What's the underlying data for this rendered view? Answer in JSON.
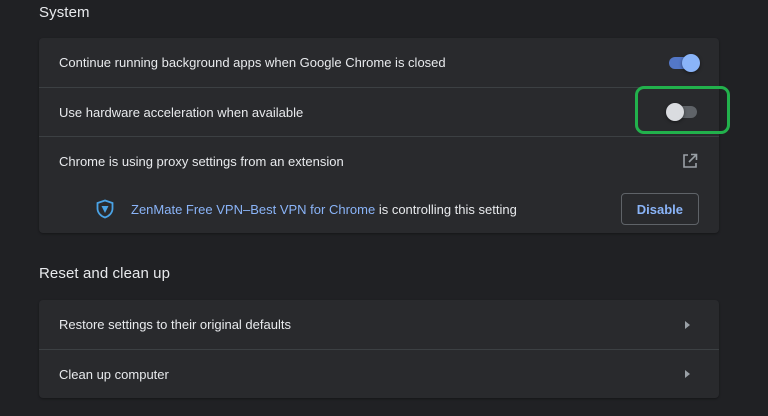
{
  "system": {
    "title": "System",
    "rows": [
      {
        "label": "Continue running background apps when Google Chrome is closed",
        "toggle": "on"
      },
      {
        "label": "Use hardware acceleration when available",
        "toggle": "off"
      },
      {
        "label": "Chrome is using proxy settings from an extension",
        "icon": "open-in-new-icon"
      }
    ],
    "extension": {
      "icon": "zenmate-shield-icon",
      "name": "ZenMate Free VPN–Best VPN for Chrome",
      "suffix": " is controlling this setting",
      "button": "Disable"
    }
  },
  "reset": {
    "title": "Reset and clean up",
    "rows": [
      {
        "label": "Restore settings to their original defaults",
        "icon": "chevron-right-icon"
      },
      {
        "label": "Clean up computer",
        "icon": "chevron-right-icon"
      }
    ]
  },
  "colors": {
    "background": "#202124",
    "card": "#292a2d",
    "accent": "#8ab4f8",
    "highlight": "#22b14c"
  }
}
